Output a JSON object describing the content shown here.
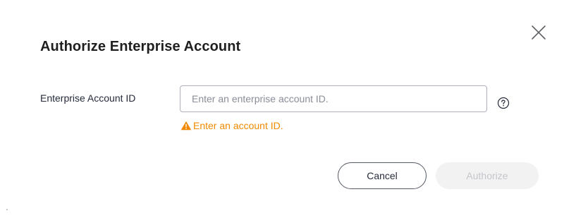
{
  "dialog": {
    "title": "Authorize Enterprise Account",
    "close_icon": "close-icon"
  },
  "form": {
    "field_label": "Enterprise Account ID",
    "input_value": "",
    "input_placeholder": "Enter an enterprise account ID.",
    "help_icon": "question-circle-icon",
    "error_icon": "warning-triangle-icon",
    "error_text": "Enter an account ID."
  },
  "footer": {
    "cancel_label": "Cancel",
    "authorize_label": "Authorize",
    "authorize_enabled": false
  },
  "colors": {
    "error": "#f08a00",
    "input_border": "#adb0b8",
    "disabled_bg": "#f2f2f2",
    "disabled_text": "#c4c6cc"
  }
}
